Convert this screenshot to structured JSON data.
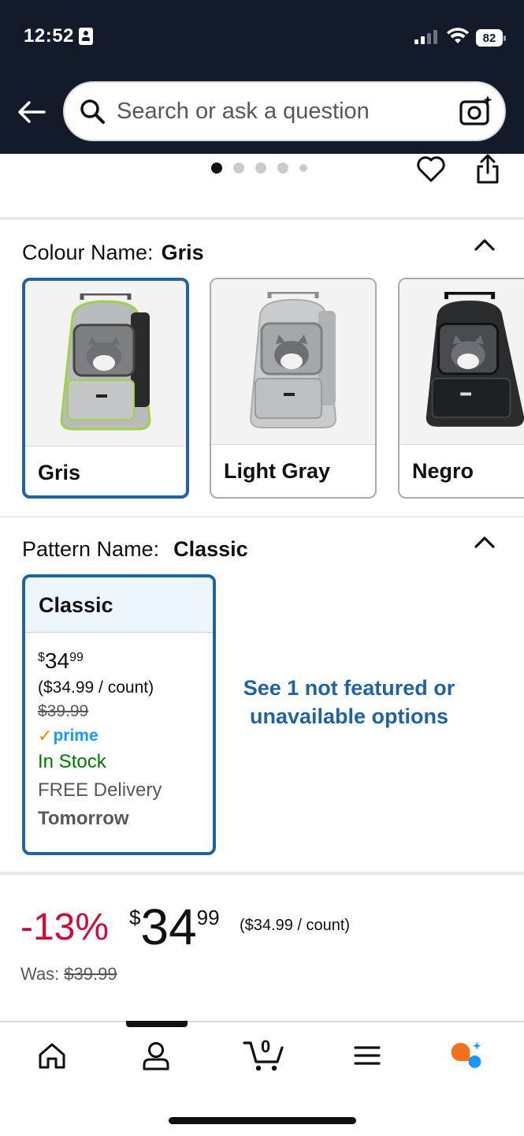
{
  "status_bar": {
    "time": "12:52",
    "battery": "82"
  },
  "search": {
    "placeholder": "Search or ask a question"
  },
  "colour": {
    "label": "Colour Name:",
    "selected": "Gris",
    "options": [
      {
        "label": "Gris",
        "selected": true
      },
      {
        "label": "Light Gray",
        "selected": false
      },
      {
        "label": "Negro",
        "selected": false
      }
    ]
  },
  "pattern": {
    "label": "Pattern Name:",
    "selected": "Classic",
    "card": {
      "name": "Classic",
      "price_symbol": "$",
      "price_whole": "34",
      "price_cents": "99",
      "unit_price": "($34.99 / count)",
      "was_price": "$39.99",
      "prime": "prime",
      "stock": "In Stock",
      "delivery": "FREE Delivery",
      "delivery_day": "Tomorrow"
    },
    "see_more": "See 1 not featured or unavailable options"
  },
  "price": {
    "discount": "-13%",
    "symbol": "$",
    "whole": "34",
    "cents": "99",
    "unit": "($34.99 / count)",
    "was_label": "Was:",
    "was_price": "$39.99"
  },
  "cart_count": "0",
  "colors": {
    "header_bg": "#131a2a",
    "selected_border": "#2162a1",
    "discount": "#cc0c39",
    "in_stock": "#007600",
    "prime": "#1a98ff",
    "link": "#2162a1"
  },
  "icons": [
    "back-arrow-icon",
    "search-icon",
    "camera-icon",
    "heart-icon",
    "share-icon",
    "chevron-up-icon",
    "home-icon",
    "account-icon",
    "cart-icon",
    "menu-icon",
    "rufus-icon"
  ]
}
